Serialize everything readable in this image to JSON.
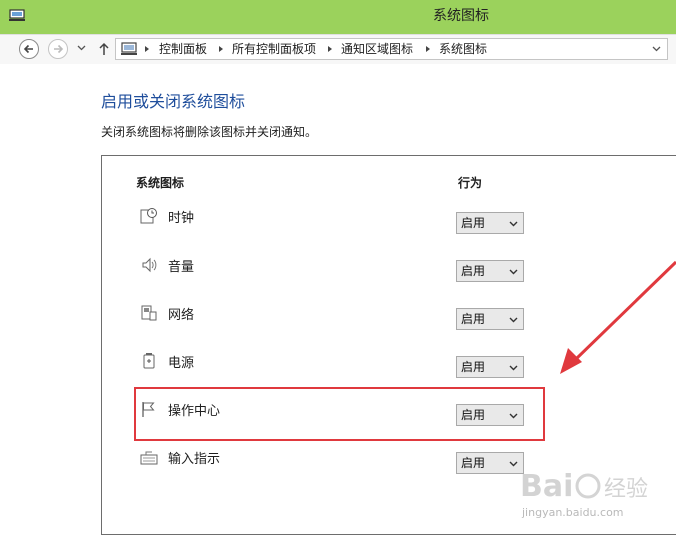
{
  "window": {
    "title": "系统图标"
  },
  "nav": {
    "breadcrumbs": [
      "控制面板",
      "所有控制面板项",
      "通知区域图标",
      "系统图标"
    ]
  },
  "content": {
    "heading": "启用或关闭系统图标",
    "description": "关闭系统图标将删除该图标并关闭通知。",
    "columns": {
      "icon": "系统图标",
      "behavior": "行为"
    },
    "rows": [
      {
        "label": "时钟",
        "value": "启用",
        "icon": "clock-icon"
      },
      {
        "label": "音量",
        "value": "启用",
        "icon": "volume-icon"
      },
      {
        "label": "网络",
        "value": "启用",
        "icon": "network-icon"
      },
      {
        "label": "电源",
        "value": "启用",
        "icon": "power-icon"
      },
      {
        "label": "操作中心",
        "value": "启用",
        "icon": "flag-icon"
      },
      {
        "label": "输入指示",
        "value": "启用",
        "icon": "keyboard-icon"
      }
    ]
  },
  "annotation": {
    "highlight_color": "#e0393e",
    "highlighted_row": "操作中心"
  },
  "watermark": {
    "brand": "Bai 经验",
    "site": "jingyan.baidu.com"
  },
  "colors": {
    "titlebar": "#9bd25c",
    "heading": "#1f4e9c"
  }
}
